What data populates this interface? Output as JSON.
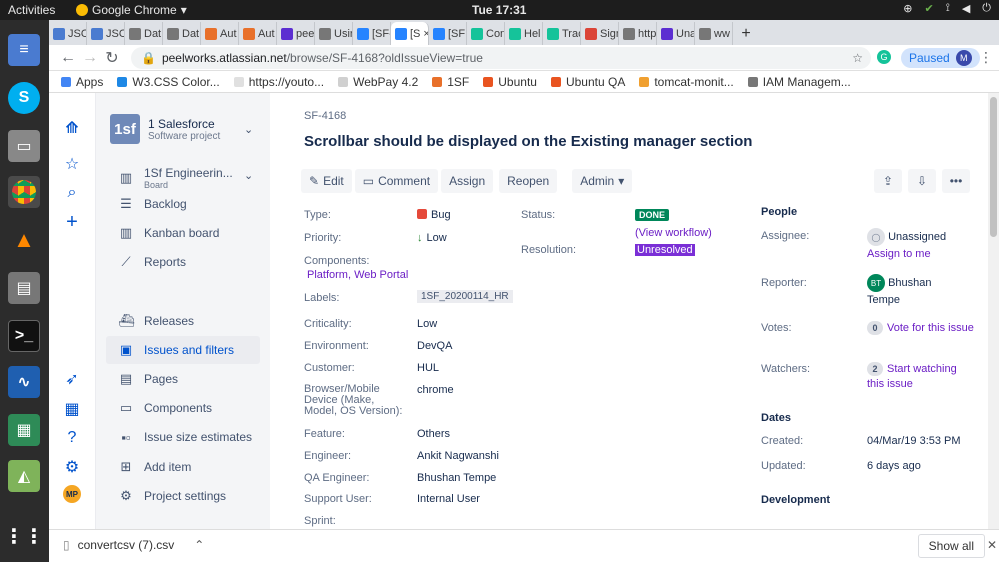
{
  "os": {
    "activities": "Activities",
    "app_name": "Google Chrome",
    "clock": "Tue 17:31"
  },
  "tabs": [
    {
      "label": "JSO",
      "color": "#4a7bd0"
    },
    {
      "label": "JSO",
      "color": "#4a7bd0"
    },
    {
      "label": "Dat",
      "color": "#777777"
    },
    {
      "label": "Dat",
      "color": "#777777"
    },
    {
      "label": "Aut",
      "color": "#e8702a"
    },
    {
      "label": "Aut",
      "color": "#e8702a"
    },
    {
      "label": "pee",
      "color": "#5c2ed1"
    },
    {
      "label": "Usir",
      "color": "#777777"
    },
    {
      "label": "[SF-",
      "color": "#2684ff"
    },
    {
      "label": "[S",
      "color": "#2684ff",
      "active": true
    },
    {
      "label": "[SF",
      "color": "#2684ff"
    },
    {
      "label": "Con",
      "color": "#15c39a"
    },
    {
      "label": "Hel",
      "color": "#15c39a"
    },
    {
      "label": "Trac",
      "color": "#15c39a"
    },
    {
      "label": "Sign",
      "color": "#db4437"
    },
    {
      "label": "http",
      "color": "#777777"
    },
    {
      "label": "Una",
      "color": "#5c2ed1"
    },
    {
      "label": "ww",
      "color": "#777777"
    }
  ],
  "address": {
    "domain": "peelworks.atlassian.net",
    "path": "/browse/SF-4168?oldIssueView=true",
    "paused_label": "Paused",
    "profile_initial": "M"
  },
  "bookmarks": [
    "Apps",
    "W3.CSS Color...",
    "https://youto...",
    "WebPay 4.2",
    "1SF",
    "Ubuntu",
    "Ubuntu QA",
    "tomcat-monit...",
    "IAM Managem..."
  ],
  "project": {
    "logo": "1sf",
    "name": "1 Salesforce",
    "type": "Software project"
  },
  "board": {
    "name": "1Sf Engineerin...",
    "type": "Board"
  },
  "nav": [
    {
      "label": "Backlog",
      "icon": "backlog-icon"
    },
    {
      "label": "Kanban board",
      "icon": "kanban-icon"
    },
    {
      "label": "Reports",
      "icon": "reports-icon"
    },
    {
      "label": "Releases",
      "icon": "releases-icon"
    },
    {
      "label": "Issues and filters",
      "icon": "issues-icon",
      "selected": true
    },
    {
      "label": "Pages",
      "icon": "pages-icon"
    },
    {
      "label": "Components",
      "icon": "components-icon"
    },
    {
      "label": "Issue size estimates",
      "icon": "estimates-icon"
    },
    {
      "label": "Add item",
      "icon": "add-item-icon"
    },
    {
      "label": "Project settings",
      "icon": "settings-icon"
    }
  ],
  "issue": {
    "key": "SF-4168",
    "summary": "Scrollbar should be displayed on the Existing manager section",
    "ops": {
      "edit": "Edit",
      "comment": "Comment",
      "assign": "Assign",
      "reopen": "Reopen",
      "admin": "Admin"
    },
    "labels_text": {
      "type": "Type:",
      "priority": "Priority:",
      "components": "Components:",
      "labels": "Labels:",
      "criticality": "Criticality:",
      "environment": "Environment:",
      "customer": "Customer:",
      "browser": "Browser/Mobile Device (Make, Model, OS Version):",
      "feature": "Feature:",
      "engineer": "Engineer:",
      "qa": "QA Engineer:",
      "support": "Support User:",
      "sprint": "Sprint:",
      "status": "Status:",
      "resolution": "Resolution:"
    },
    "values": {
      "type": "Bug",
      "priority": "Low",
      "components": "Platform, Web Portal",
      "labels": "1SF_20200114_HR",
      "criticality": "Low",
      "environment": "DevQA",
      "customer": "HUL",
      "browser": "chrome",
      "feature": "Others",
      "engineer": "Ankit Nagwanshi",
      "qa": "Bhushan Tempe",
      "support": "Internal User",
      "status": "DONE",
      "view_workflow": "(View workflow)",
      "resolution": "Unresolved"
    },
    "people": {
      "title": "People",
      "assignee_label": "Assignee:",
      "assignee": "Unassigned",
      "assign_to_me": "Assign to me",
      "reporter_label": "Reporter:",
      "reporter_initials": "BT",
      "reporter_first": "Bhushan",
      "reporter_last": "Tempe",
      "votes_label": "Votes:",
      "votes_count": "0",
      "vote_link": "Vote for this issue",
      "watchers_label": "Watchers:",
      "watchers_count": "2",
      "watch_link_1": "Start watching",
      "watch_link_2": "this issue"
    },
    "dates": {
      "title": "Dates",
      "created_label": "Created:",
      "created": "04/Mar/19 3:53 PM",
      "updated_label": "Updated:",
      "updated": "6 days ago"
    },
    "development_title": "Development"
  },
  "downloads": {
    "file": "convertcsv (7).csv",
    "show_all": "Show all"
  },
  "colors": {
    "accent": "#0052cc",
    "done": "#00875a",
    "unresolved": "#7a2fd6",
    "link": "#6b1ec5"
  }
}
